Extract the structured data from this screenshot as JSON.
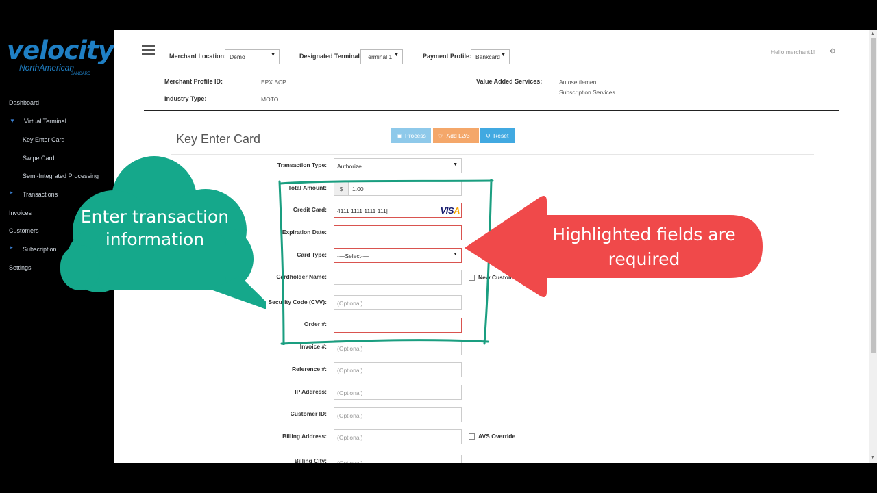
{
  "logo": {
    "word": "velocity",
    "line1": "NorthAmerican",
    "line2": "BANCARD"
  },
  "sidebar": {
    "items": [
      {
        "label": "Dashboard"
      },
      {
        "label": "Virtual Terminal"
      },
      {
        "label": "Key Enter Card"
      },
      {
        "label": "Swipe Card"
      },
      {
        "label": "Semi-Integrated Processing"
      },
      {
        "label": "Transactions"
      },
      {
        "label": "Invoices"
      },
      {
        "label": "Customers"
      },
      {
        "label": "Subscription"
      },
      {
        "label": "Settings"
      }
    ]
  },
  "header": {
    "merchant_location_label": "Merchant Location:",
    "merchant_location_value": "Demo",
    "designated_terminal_label": "Designated Terminal:",
    "designated_terminal_value": "Terminal 1",
    "payment_profile_label": "Payment Profile:",
    "payment_profile_value": "Bankcard",
    "greeting": "Hello merchant1!",
    "merchant_profile_id_label": "Merchant Profile ID:",
    "merchant_profile_id_value": "EPX BCP",
    "industry_type_label": "Industry Type:",
    "industry_type_value": "MOTO",
    "vas_label": "Value Added Services:",
    "vas_values": [
      "Autosettlement",
      "Subscription Services"
    ]
  },
  "page": {
    "title": "Key Enter Card",
    "buttons": {
      "process": "Process",
      "add_l23": "Add L2/3",
      "reset": "Reset"
    }
  },
  "form": {
    "transaction_type": {
      "label": "Transaction Type:",
      "value": "Authorize"
    },
    "total_amount": {
      "label": "Total Amount:",
      "prefix": "$",
      "value": "1.00"
    },
    "credit_card": {
      "label": "Credit Card:",
      "value": "4111 1111 1111 111",
      "brand": "VISA"
    },
    "expiration_date": {
      "label": "Expiration Date:",
      "value": ""
    },
    "card_type": {
      "label": "Card Type:",
      "value": "----Select----"
    },
    "cardholder_name": {
      "label": "Cardholder Name:",
      "value": ""
    },
    "new_customer": {
      "label": "New Customer"
    },
    "security_code": {
      "label": "Security Code (CVV):",
      "placeholder": "(Optional)"
    },
    "order_number": {
      "label": "Order #:",
      "value": ""
    },
    "invoice_number": {
      "label": "Invoice #:",
      "placeholder": "(Optional)"
    },
    "reference_number": {
      "label": "Reference #:",
      "placeholder": "(Optional)"
    },
    "ip_address": {
      "label": "IP Address:",
      "placeholder": "(Optional)"
    },
    "customer_id": {
      "label": "Customer ID:",
      "placeholder": "(Optional)"
    },
    "billing_address": {
      "label": "Billing Address:",
      "placeholder": "(Optional)"
    },
    "avs_override": {
      "label": "AVS Override"
    },
    "billing_city": {
      "label": "Billing City:",
      "placeholder": "(Optional)"
    }
  },
  "overlays": {
    "bubble_text": "Enter transaction information",
    "arrow_text": "Highlighted fields are required",
    "colors": {
      "bubble": "#15a88b",
      "arrow": "#f0494a",
      "box": "#1a9e80"
    }
  },
  "colors": {
    "process_button": "#8ec9ea",
    "add_button": "#f4a76a",
    "reset_button": "#41a9e1",
    "required_border": "#d9534f",
    "sidebar_bg": "#000000"
  }
}
